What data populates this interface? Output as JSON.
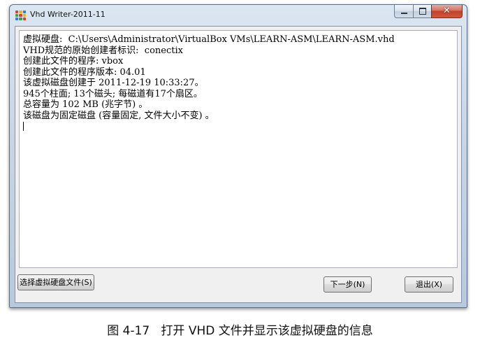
{
  "window": {
    "title": "Vhd Writer-2011-11",
    "icon": "vhd-writer-app-icon",
    "close_glyph": "✕"
  },
  "info": {
    "lines": [
      "虚拟硬盘:  C:\\Users\\Administrator\\VirtualBox VMs\\LEARN-ASM\\LEARN-ASM.vhd",
      "VHD规范的原始创建者标识:  conectix",
      "创建此文件的程序: vbox",
      "创建此文件的程序版本: 04.01",
      "该虚拟磁盘创建于 2011-12-19 10:33:27。",
      "945个柱面; 13个磁头; 每磁道有17个扇区。",
      "总容量为 102 MB (兆字节) 。",
      "该磁盘为固定磁盘 (容量固定, 文件大小不变) 。"
    ]
  },
  "buttons": {
    "select_vhd": "选择虚拟硬盘文件(S)",
    "next": "下一步(N)",
    "exit": "退出(X)"
  },
  "caption": "图 4-17   打开 VHD 文件并显示该虚拟硬盘的信息",
  "colors": {
    "icon_cells": [
      "#e23b2e",
      "#f4b400",
      "#2e7dd8",
      "#3aa34a",
      "#e23b2e",
      "#f4b400",
      "#2e7dd8",
      "#3aa34a",
      "#e23b2e"
    ]
  }
}
